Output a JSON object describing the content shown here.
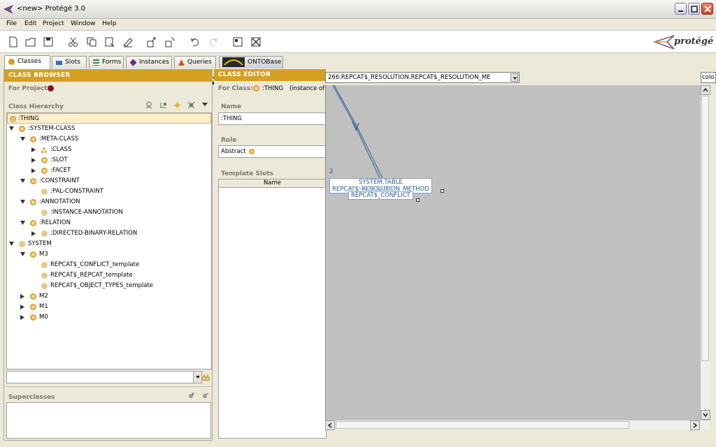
{
  "window": {
    "title": "<new>  Protégé 3.0"
  },
  "menu": [
    "File",
    "Edit",
    "Project",
    "Window",
    "Help"
  ],
  "logo_text": "protégé",
  "tabs": [
    "Classes",
    "Slots",
    "Forms",
    "Instances",
    "Queries",
    "ONTOBase"
  ],
  "browser": {
    "header": "CLASS BROWSER",
    "for_project_label": "For Project:",
    "hierarchy_label": "Class Hierarchy",
    "superclasses_label": "Superclasses",
    "tree": [
      ":THING",
      ":SYSTEM-CLASS",
      ":META-CLASS",
      ":CLASS",
      ":SLOT",
      ":FACET",
      ":CONSTRAINT",
      ":PAL-CONSTRAINT",
      ":ANNOTATION",
      ":INSTANCE-ANNOTATION",
      ":RELATION",
      ":DIRECTED-BINARY-RELATION",
      "SYSTEM",
      "M3",
      "REPCAT$_CONFLICT_template",
      "REPCAT$_REPCAT_template",
      "REPCAT$_OBJECT_TYPES_template",
      "M2",
      "M1",
      "M0"
    ]
  },
  "editor": {
    "header": "CLASS EDITOR",
    "for_class_label": "For Class:",
    "for_class_value": ":THING",
    "instance_of": "(instance of :",
    "name_label": "Name",
    "name_value": ":THING",
    "role_label": "Role",
    "role_value": "Abstract",
    "template_slots_label": "Template Slots",
    "column_name": "Name"
  },
  "diagram": {
    "combo_value": "266.REPCAT$_RESOLUTION.REPCAT$_RESOLUTION_ME",
    "right_combo": "colo",
    "edge_label": "2",
    "node1_line1": "SYSTEM.TABLE",
    "node1_line2": "REPCAT$_RESOLUTION_METHOD",
    "node2_overlap": "SYSTEM.TABLE",
    "node2_line": "REPCAT$_CONFLICT"
  },
  "colors": {
    "header": "#d4a020",
    "diagram_bg": "#c0c0c0",
    "node_text": "#2a5d90"
  }
}
